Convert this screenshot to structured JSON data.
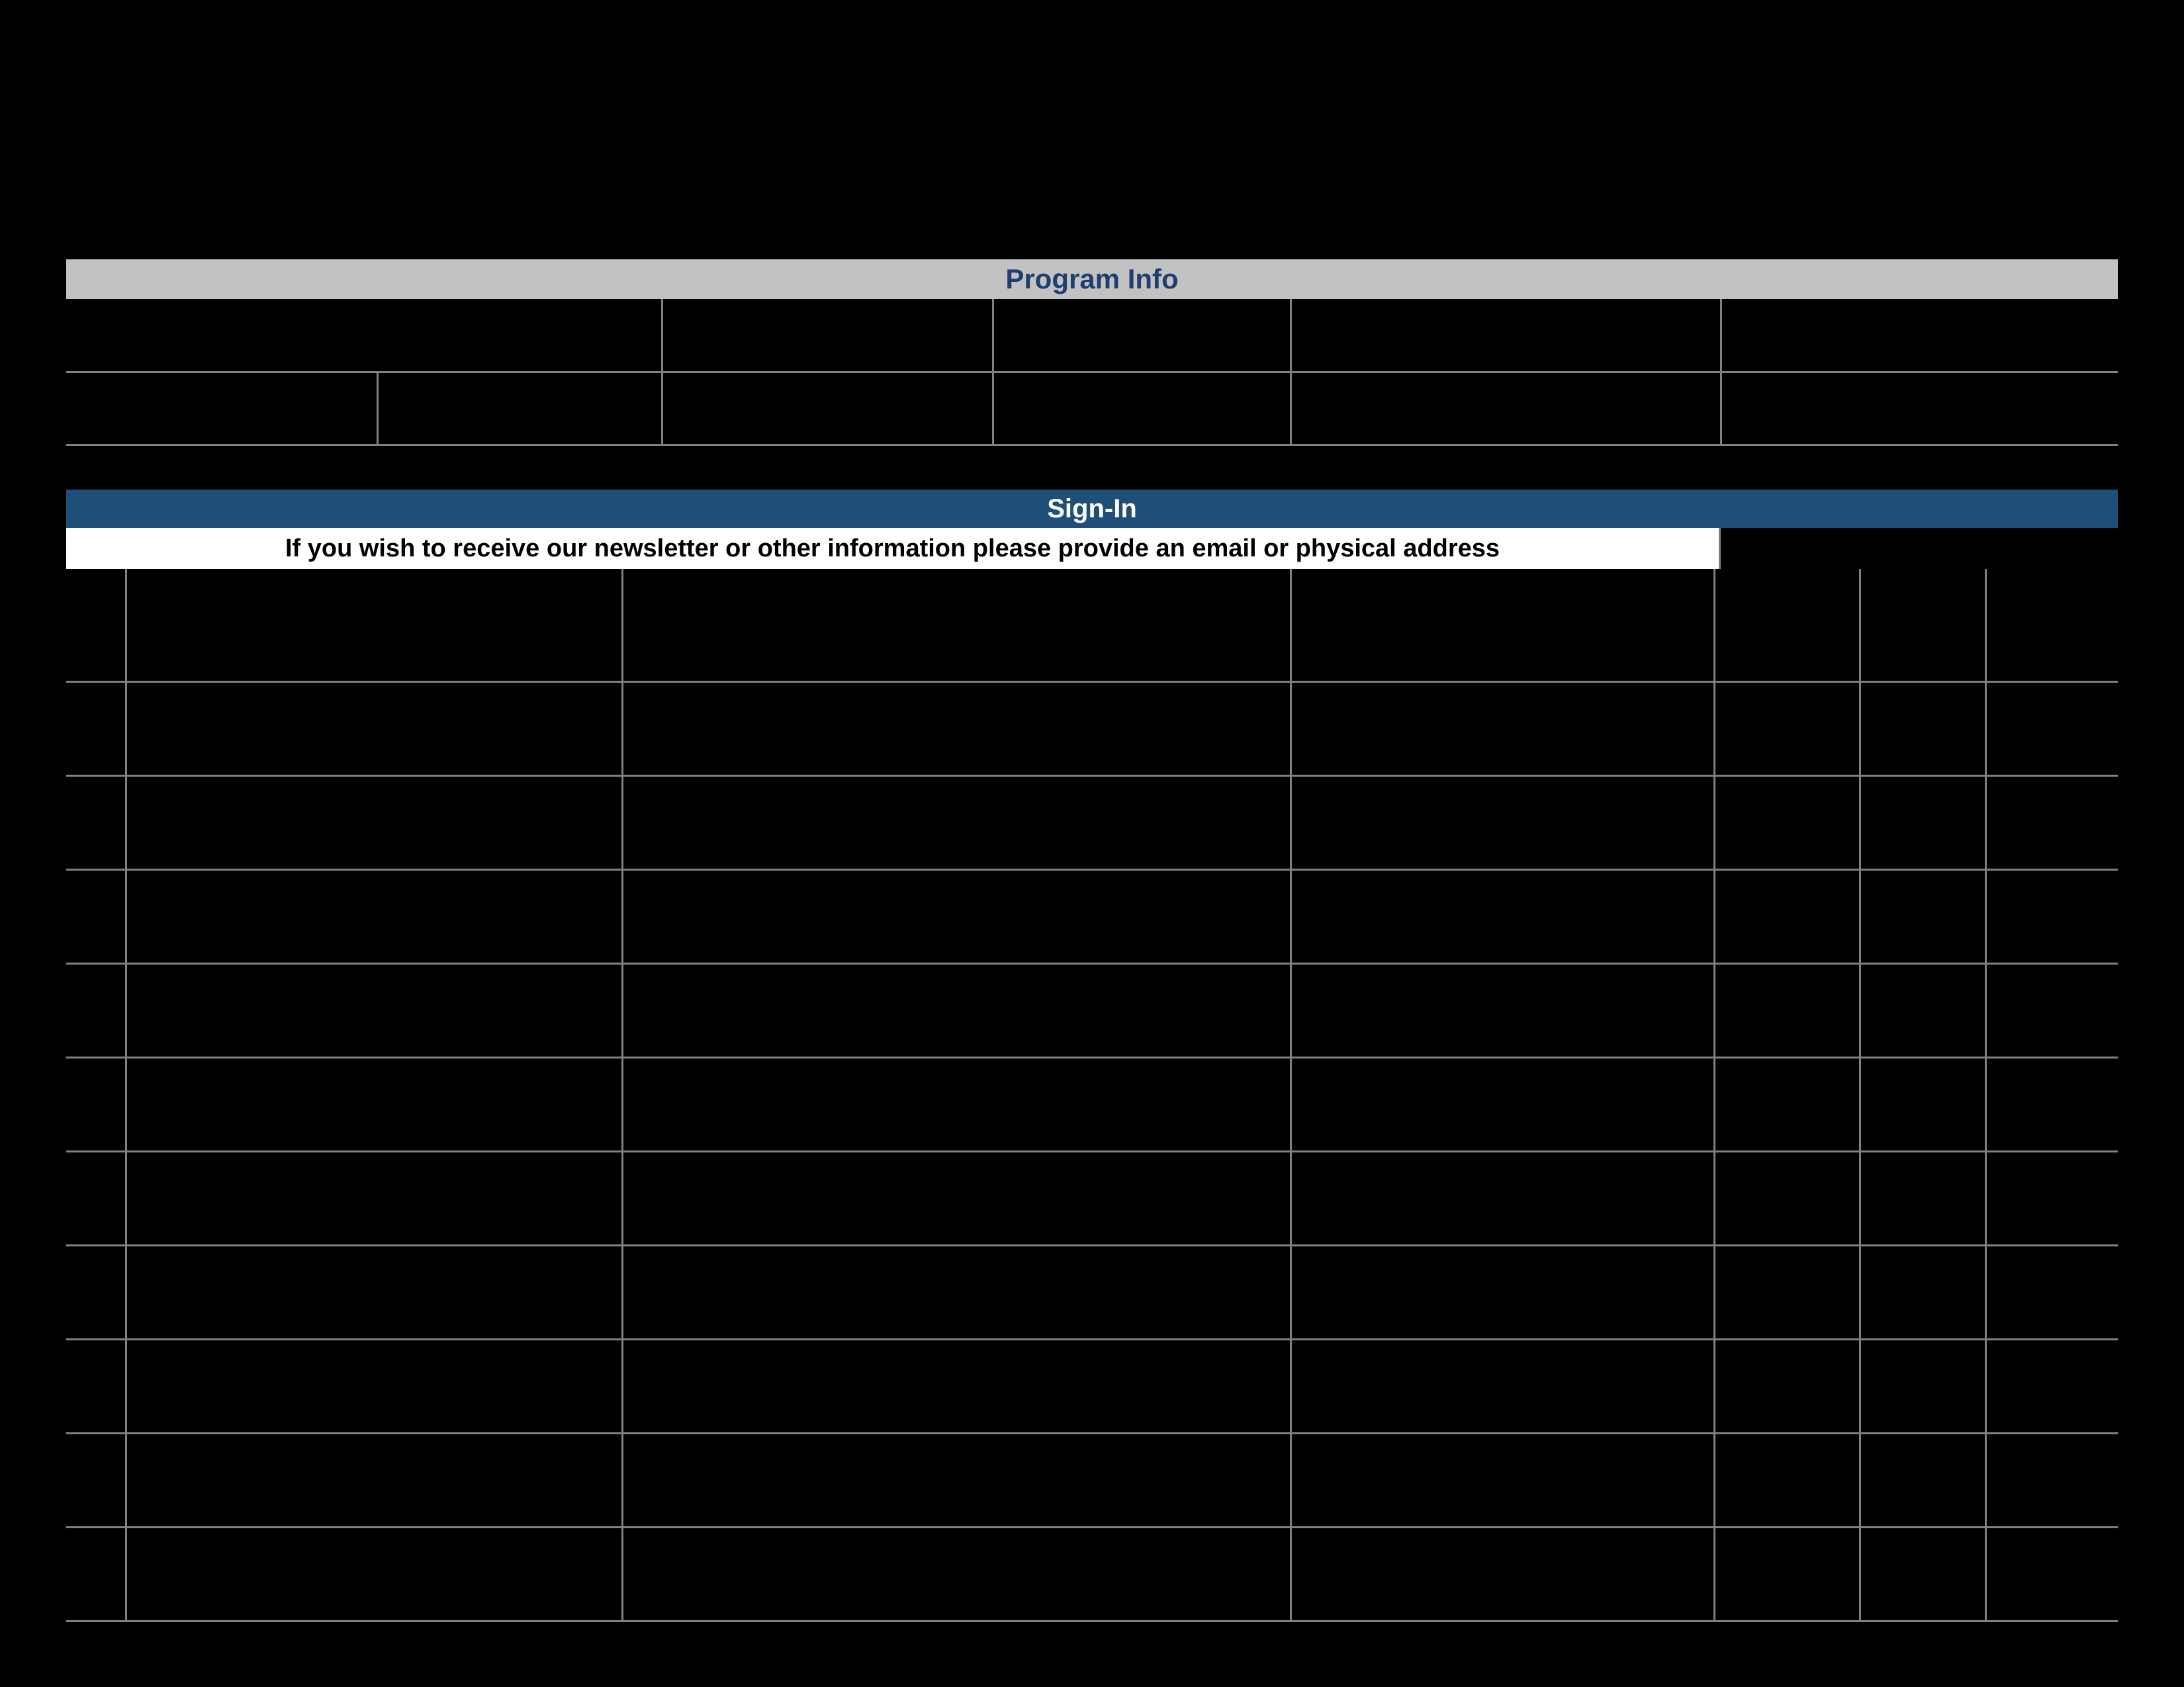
{
  "program_info": {
    "header": "Program Info",
    "row1": [
      "",
      "",
      "",
      "",
      "",
      ""
    ],
    "row2": [
      "",
      "",
      "",
      "",
      "",
      ""
    ]
  },
  "signin": {
    "header": "Sign-In",
    "newsletter_note": "If you wish to receive our newsletter or other information please provide an email or physical address",
    "columns": [
      "",
      "",
      "",
      "",
      "",
      "",
      ""
    ],
    "rows": [
      [
        "",
        "",
        "",
        "",
        "",
        "",
        ""
      ],
      [
        "",
        "",
        "",
        "",
        "",
        "",
        ""
      ],
      [
        "",
        "",
        "",
        "",
        "",
        "",
        ""
      ],
      [
        "",
        "",
        "",
        "",
        "",
        "",
        ""
      ],
      [
        "",
        "",
        "",
        "",
        "",
        "",
        ""
      ],
      [
        "",
        "",
        "",
        "",
        "",
        "",
        ""
      ],
      [
        "",
        "",
        "",
        "",
        "",
        "",
        ""
      ],
      [
        "",
        "",
        "",
        "",
        "",
        "",
        ""
      ],
      [
        "",
        "",
        "",
        "",
        "",
        "",
        ""
      ],
      [
        "",
        "",
        "",
        "",
        "",
        "",
        ""
      ]
    ]
  }
}
